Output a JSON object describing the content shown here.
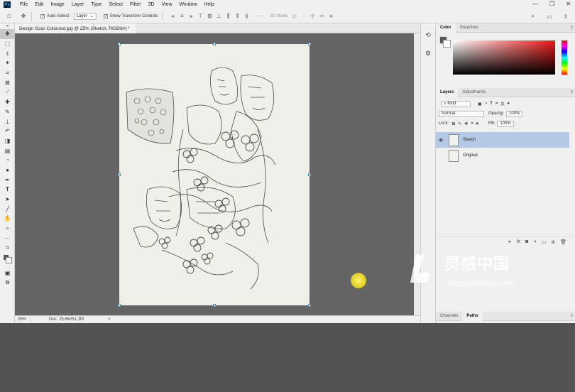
{
  "menubar": {
    "app_icon": "Ps",
    "items": [
      "File",
      "Edit",
      "Image",
      "Layer",
      "Type",
      "Select",
      "Filter",
      "3D",
      "View",
      "Window",
      "Help"
    ],
    "window_buttons": [
      "—",
      "❐",
      "✕"
    ]
  },
  "options": {
    "auto_select_label": "Auto-Select:",
    "auto_select_value": "Layer",
    "transform_label": "Show Transform Controls",
    "mode_label": "3D Mode:"
  },
  "document": {
    "tab_title": "Design Scan Coloured.jpg @ 25% (Sketch, RGB/8#) *",
    "tab_close": "×"
  },
  "status": {
    "zoom": "25%",
    "doc_info": "Doc: 25.6M/51.3M",
    "arrow": ">"
  },
  "color_panel": {
    "tabs": [
      "Color",
      "Swatches"
    ],
    "fg_color": "#5a5a5a",
    "bg_color": "#ffffff"
  },
  "layers_panel": {
    "tabs": [
      "Layers",
      "Adjustments"
    ],
    "kind_label": "Kind",
    "blend_mode": "Normal",
    "opacity_label": "Opacity:",
    "opacity_value": "100%",
    "lock_label": "Lock:",
    "fill_label": "Fill:",
    "fill_value": "100%",
    "layers": [
      {
        "name": "Sketch",
        "visible": true,
        "selected": true
      },
      {
        "name": "Original",
        "visible": false,
        "selected": false
      }
    ],
    "footer_icons": [
      "link-icon",
      "fx-icon",
      "mask-icon",
      "adjustment-icon",
      "group-icon",
      "new-layer-icon",
      "trash-icon"
    ]
  },
  "channels_panel": {
    "tabs": [
      "Channels",
      "Paths"
    ]
  },
  "watermark": {
    "chinese": "灵感中国",
    "url": "lingganchina.com"
  },
  "accent_color": "#31a8ff",
  "selection_color": "#b4c9e6"
}
